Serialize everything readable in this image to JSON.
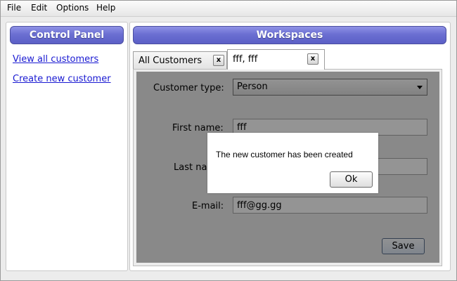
{
  "menu": {
    "items": [
      "File",
      "Edit",
      "Options",
      "Help"
    ]
  },
  "control_panel": {
    "title": "Control Panel",
    "links": [
      "View all customers",
      "Create new customer"
    ]
  },
  "workspaces": {
    "title": "Workspaces",
    "tabs": [
      {
        "label": "All Customers",
        "close": "x"
      },
      {
        "label": "fff, fff",
        "close": "x"
      }
    ]
  },
  "form": {
    "customer_type": {
      "label": "Customer type:",
      "value": "Person"
    },
    "first_name": {
      "label": "First name:",
      "value": "fff"
    },
    "last_name": {
      "label": "Last na",
      "value": ""
    },
    "email": {
      "label": "E-mail:",
      "value": "fff@gg.gg"
    },
    "save_label": "Save"
  },
  "dialog": {
    "message": "The new customer has been created",
    "ok_label": "Ok"
  }
}
